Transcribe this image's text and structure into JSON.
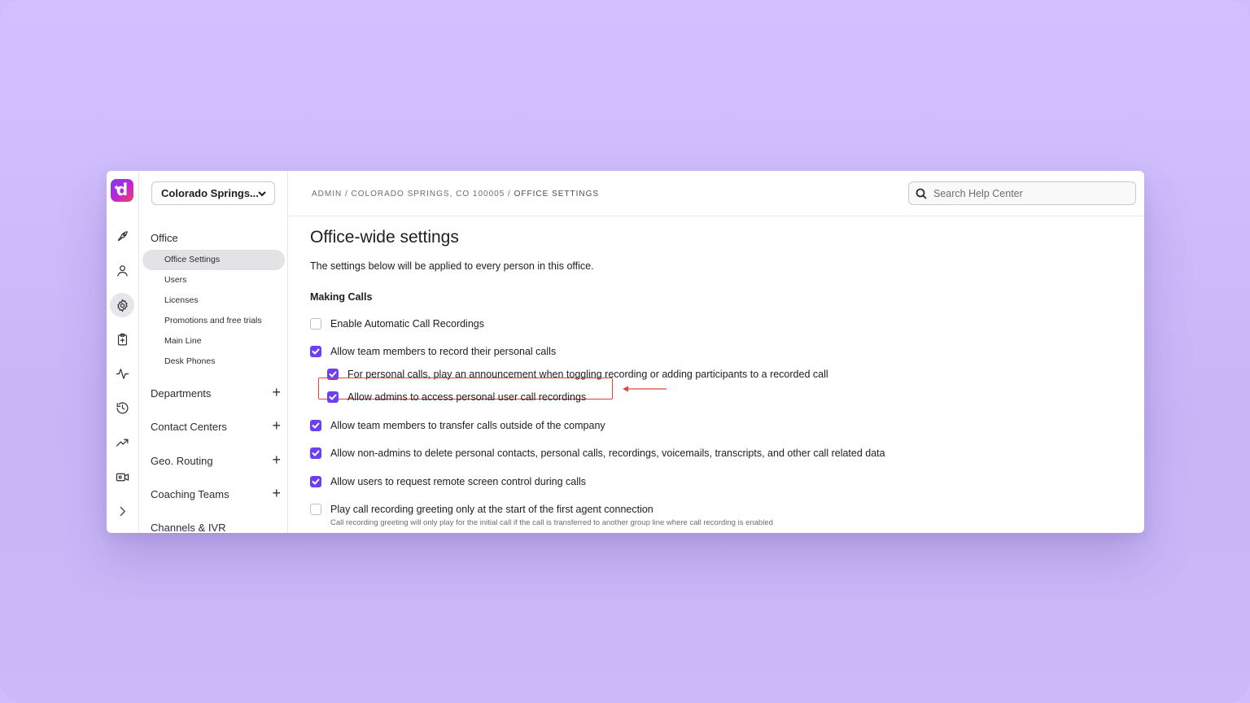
{
  "office_selector": {
    "label": "Colorado Springs..."
  },
  "rail": {
    "items": [
      {
        "name": "rocket-icon"
      },
      {
        "name": "person-icon"
      },
      {
        "name": "gear-icon",
        "active": true
      },
      {
        "name": "clipboard-icon"
      },
      {
        "name": "activity-icon"
      },
      {
        "name": "history-icon"
      },
      {
        "name": "trending-icon"
      },
      {
        "name": "video-icon"
      },
      {
        "name": "chevron-right-icon"
      }
    ]
  },
  "sidebar": {
    "section": "Office",
    "items": [
      {
        "label": "Office Settings",
        "active": true
      },
      {
        "label": "Users"
      },
      {
        "label": "Licenses"
      },
      {
        "label": "Promotions and free trials"
      },
      {
        "label": "Main Line"
      },
      {
        "label": "Desk Phones"
      }
    ],
    "groups": [
      {
        "label": "Departments"
      },
      {
        "label": "Contact Centers"
      },
      {
        "label": "Geo. Routing"
      },
      {
        "label": "Coaching Teams"
      },
      {
        "label": "Channels & IVR"
      }
    ]
  },
  "breadcrumb": {
    "parts": "ADMIN / COLORADO SPRINGS, CO 100005 / ",
    "current": "OFFICE SETTINGS"
  },
  "search": {
    "placeholder": "Search Help Center"
  },
  "main": {
    "title": "Office-wide settings",
    "subtitle": "The settings below will be applied to every person in this office.",
    "section": "Making Calls",
    "options": [
      {
        "label": "Enable Automatic Call Recordings",
        "checked": false
      },
      {
        "label": "Allow team members to record their personal calls",
        "checked": true
      },
      {
        "label": "For personal calls, play an announcement when toggling recording or adding participants to a recorded call",
        "checked": true
      },
      {
        "label": "Allow admins to access personal user call recordings",
        "checked": true
      },
      {
        "label": "Allow team members to transfer calls outside of the company",
        "checked": true
      },
      {
        "label": "Allow non-admins to delete personal contacts, personal calls, recordings, voicemails, transcripts, and other call related data",
        "checked": true
      },
      {
        "label": "Allow users to request remote screen control during calls",
        "checked": true
      },
      {
        "label": "Play call recording greeting only at the start of the first agent connection",
        "checked": false,
        "hint": "Call recording greeting will only play for the initial call if the call is transferred to another group line where call recording is enabled"
      }
    ]
  },
  "colors": {
    "accent": "#6d3ff2",
    "highlight": "#e0443e",
    "background": "#cfbdfd"
  }
}
